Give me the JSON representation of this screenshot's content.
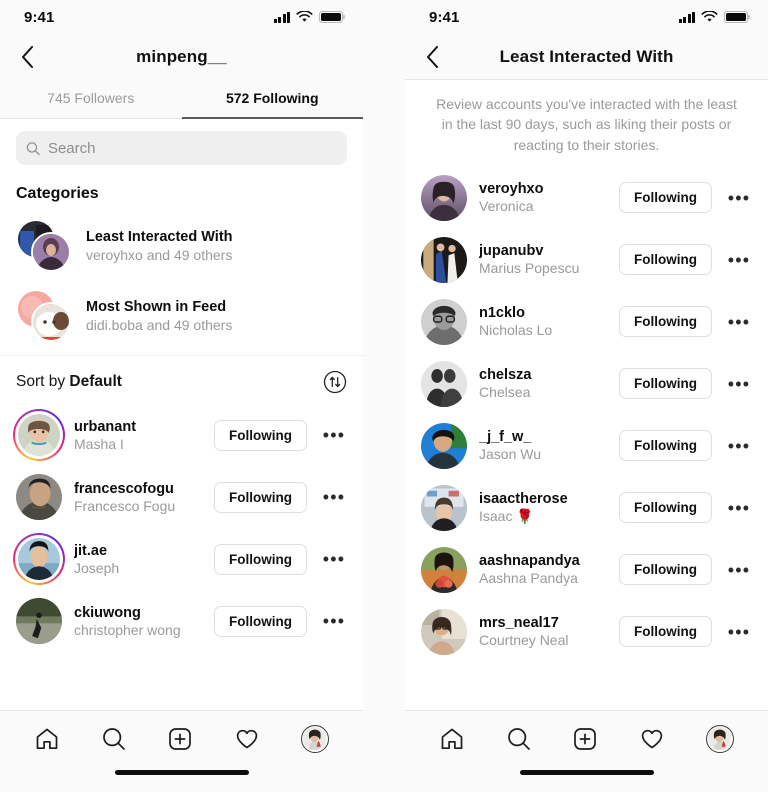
{
  "left": {
    "status": {
      "time": "9:41",
      "signal_icon": "signal-bars-icon",
      "wifi_icon": "wifi-icon",
      "battery_icon": "battery-full-icon"
    },
    "nav": {
      "back_icon": "chevron-left-icon",
      "title": "minpeng__"
    },
    "tabs": [
      {
        "label": "745 Followers",
        "active": false
      },
      {
        "label": "572 Following",
        "active": true
      }
    ],
    "search": {
      "placeholder": "Search",
      "value": "",
      "icon": "search-icon"
    },
    "categories_title": "Categories",
    "categories": [
      {
        "name": "Least Interacted With",
        "subtitle": "veroyhxo and 49 others"
      },
      {
        "name": "Most Shown in Feed",
        "subtitle": "didi.boba and 49 others"
      }
    ],
    "sort": {
      "prefix": "Sort by ",
      "value": "Default",
      "icon": "sort-arrows-icon"
    },
    "users": [
      {
        "username": "urbanant",
        "fullname": "Masha I",
        "button": "Following",
        "more": "•••",
        "ring": true
      },
      {
        "username": "francescofogu",
        "fullname": "Francesco Fogu",
        "button": "Following",
        "more": "•••",
        "ring": false
      },
      {
        "username": "jit.ae",
        "fullname": "Joseph",
        "button": "Following",
        "more": "•••",
        "ring": true
      },
      {
        "username": "ckiuwong",
        "fullname": "christopher wong",
        "button": "Following",
        "more": "•••",
        "ring": false
      }
    ]
  },
  "right": {
    "status": {
      "time": "9:41",
      "signal_icon": "signal-bars-icon",
      "wifi_icon": "wifi-icon",
      "battery_icon": "battery-full-icon"
    },
    "nav": {
      "back_icon": "chevron-left-icon",
      "title": "Least Interacted With"
    },
    "description": "Review accounts you've interacted with the least in the last 90 days, such as liking their posts or reacting to their stories.",
    "users": [
      {
        "username": "veroyhxo",
        "fullname": "Veronica",
        "button": "Following",
        "more": "•••"
      },
      {
        "username": "jupanubv",
        "fullname": "Marius Popescu",
        "button": "Following",
        "more": "•••"
      },
      {
        "username": "n1cklo",
        "fullname": "Nicholas Lo",
        "button": "Following",
        "more": "•••"
      },
      {
        "username": "chelsza",
        "fullname": "Chelsea",
        "button": "Following",
        "more": "•••"
      },
      {
        "username": "_j_f_w_",
        "fullname": "Jason Wu",
        "button": "Following",
        "more": "•••"
      },
      {
        "username": "isaactherose",
        "fullname": "Isaac 🌹",
        "button": "Following",
        "more": "•••"
      },
      {
        "username": "aashnapandya",
        "fullname": "Aashna Pandya",
        "button": "Following",
        "more": "•••"
      },
      {
        "username": "mrs_neal17",
        "fullname": "Courtney Neal",
        "button": "Following",
        "more": "•••"
      }
    ]
  },
  "tabbar": {
    "items": [
      {
        "icon": "home-icon"
      },
      {
        "icon": "search-icon"
      },
      {
        "icon": "plus-square-icon"
      },
      {
        "icon": "heart-icon"
      },
      {
        "icon": "profile-avatar-icon"
      }
    ]
  },
  "colors": {
    "accent": "#0d0d0d",
    "muted": "#9a9a9a",
    "bg": "#ffffff",
    "chrome": "#fafafa",
    "border": "#e6e6e6",
    "story_ring": "#ee2a7b"
  }
}
